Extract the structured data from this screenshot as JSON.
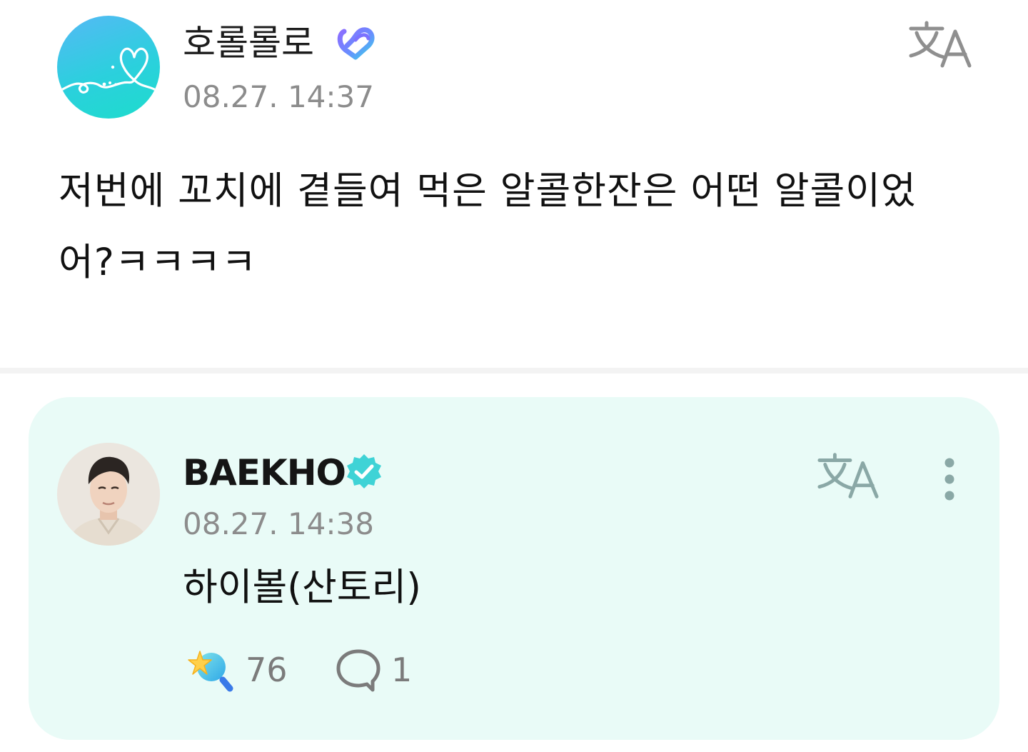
{
  "post": {
    "author": "호롤롤로",
    "timestamp": "08.27. 14:37",
    "text": "저번에 꼬치에 곁들여 먹은 알콜한잔은 어떤 알콜이었어?ㅋㅋㅋㅋ",
    "avatar_icon": "heart-scribble-avatar-icon",
    "badge_icon": "membership-badge-icon",
    "translate_icon": "translate-icon"
  },
  "reply": {
    "author": "BAEKHO",
    "timestamp": "08.27. 14:38",
    "text": "하이볼(산토리)",
    "like_count": "76",
    "comment_count": "1",
    "badge_icon": "verified-badge-icon",
    "translate_icon": "translate-icon",
    "more_icon": "more-vertical-icon",
    "like_icon": "star-wand-icon",
    "comment_icon": "speech-bubble-icon"
  },
  "colors": {
    "reply_card_bg": "#e9fbf7",
    "verified_badge": "#3fd3d6",
    "translate_post": "#8f8f8f",
    "translate_reply": "#8aa8a6",
    "timestamp": "#8c8c8c"
  }
}
